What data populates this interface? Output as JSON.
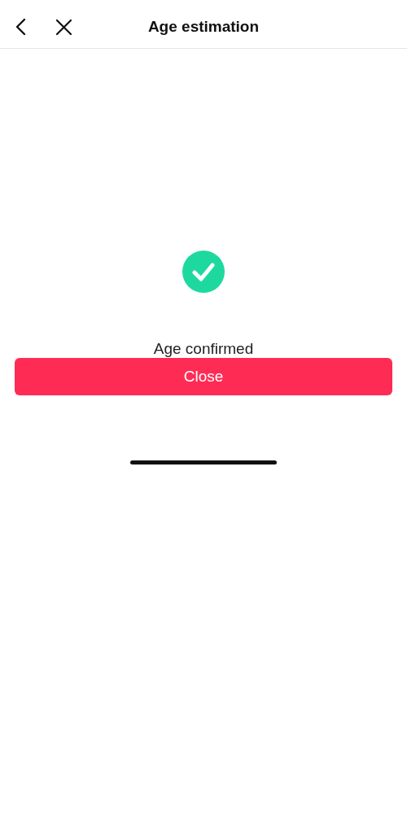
{
  "header": {
    "title": "Age estimation"
  },
  "status": {
    "kind": "success",
    "message": "Age confirmed"
  },
  "buttons": [
    {
      "label": "Close"
    }
  ]
}
